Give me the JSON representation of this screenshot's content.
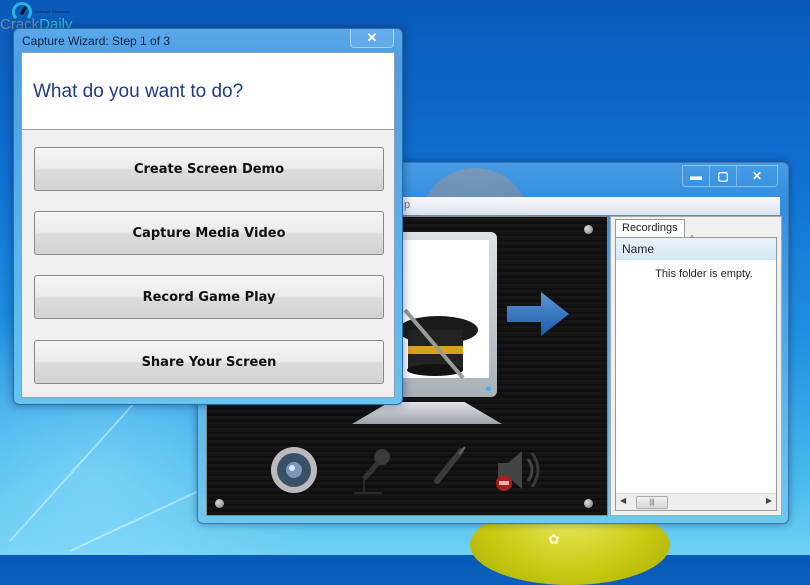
{
  "watermark": {
    "tagline": "Software Download",
    "brand_part1": "Crack",
    "brand_part2": "Daily"
  },
  "wizard": {
    "title": "Capture Wizard: Step 1 of 3",
    "close_glyph": "✕",
    "question": "What do you want to do?",
    "options": [
      {
        "label": "Create Screen Demo"
      },
      {
        "label": "Capture Media Video"
      },
      {
        "label": "Record Game Play"
      },
      {
        "label": "Share Your Screen"
      }
    ]
  },
  "main_window": {
    "caption_buttons": {
      "minimize": "▬",
      "maximize": "▢",
      "close": "✕"
    },
    "menu_visible_text": "p",
    "stage_icons": [
      "speaker-icon",
      "microphone-icon",
      "audio-jack-icon",
      "mute-speaker-icon"
    ],
    "recordings": {
      "tab_label": "Recordings",
      "column_name": "Name",
      "sort_glyph": "^",
      "empty_text": "This folder is empty.",
      "scroll_left": "◀",
      "scroll_right": "▶",
      "scroll_thumb": "|||"
    }
  }
}
